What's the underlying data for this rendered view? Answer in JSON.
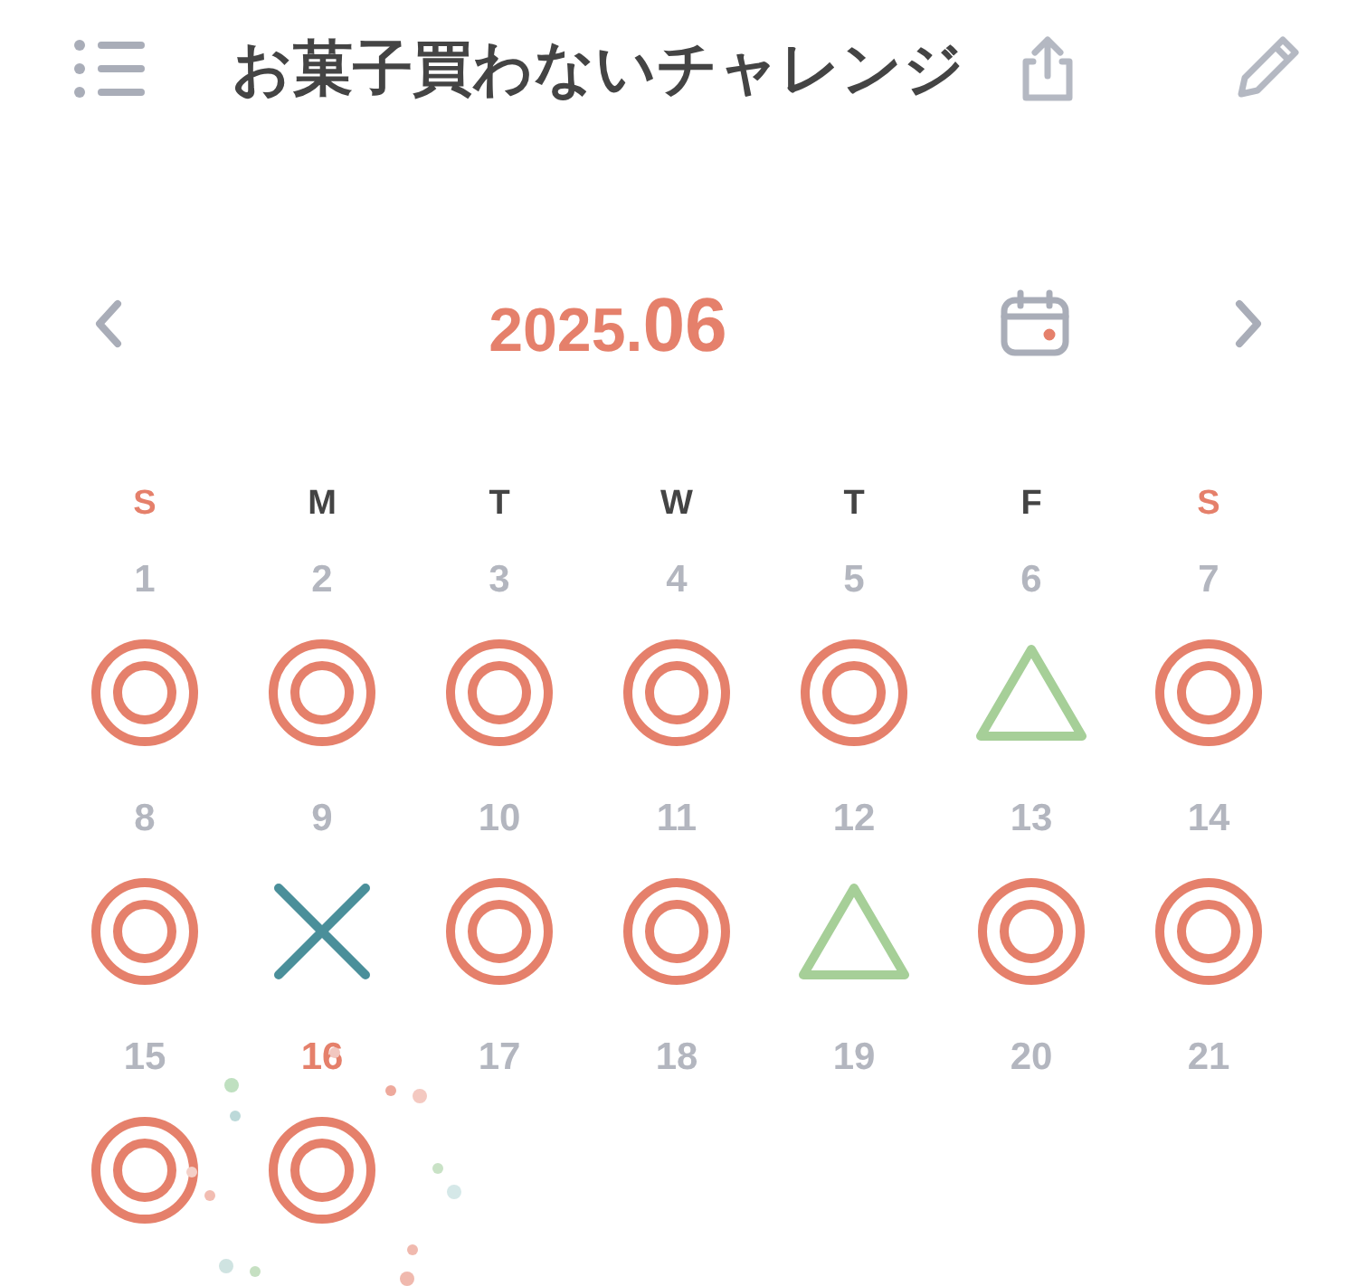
{
  "title": "お菓子買わないチャレンジ",
  "month_nav": {
    "year": "2025.",
    "month": "06"
  },
  "weekdays": [
    {
      "label": "S",
      "weekend": true
    },
    {
      "label": "M",
      "weekend": false
    },
    {
      "label": "T",
      "weekend": false
    },
    {
      "label": "W",
      "weekend": false
    },
    {
      "label": "T",
      "weekend": false
    },
    {
      "label": "F",
      "weekend": false
    },
    {
      "label": "S",
      "weekend": true
    }
  ],
  "days": [
    {
      "number": "1",
      "today": false,
      "kind": "success"
    },
    {
      "number": "2",
      "today": false,
      "kind": "success"
    },
    {
      "number": "3",
      "today": false,
      "kind": "success"
    },
    {
      "number": "4",
      "today": false,
      "kind": "success"
    },
    {
      "number": "5",
      "today": false,
      "kind": "success"
    },
    {
      "number": "6",
      "today": false,
      "kind": "partial"
    },
    {
      "number": "7",
      "today": false,
      "kind": "success"
    },
    {
      "number": "8",
      "today": false,
      "kind": "success"
    },
    {
      "number": "9",
      "today": false,
      "kind": "failed"
    },
    {
      "number": "10",
      "today": false,
      "kind": "success"
    },
    {
      "number": "11",
      "today": false,
      "kind": "success"
    },
    {
      "number": "12",
      "today": false,
      "kind": "partial"
    },
    {
      "number": "13",
      "today": false,
      "kind": "success"
    },
    {
      "number": "14",
      "today": false,
      "kind": "success"
    },
    {
      "number": "15",
      "today": false,
      "kind": "success"
    },
    {
      "number": "16",
      "today": true,
      "kind": "success"
    },
    {
      "number": "17",
      "today": false,
      "kind": "empty"
    },
    {
      "number": "18",
      "today": false,
      "kind": "empty"
    },
    {
      "number": "19",
      "today": false,
      "kind": "empty"
    },
    {
      "number": "20",
      "today": false,
      "kind": "empty"
    },
    {
      "number": "21",
      "today": false,
      "kind": "empty"
    }
  ]
}
